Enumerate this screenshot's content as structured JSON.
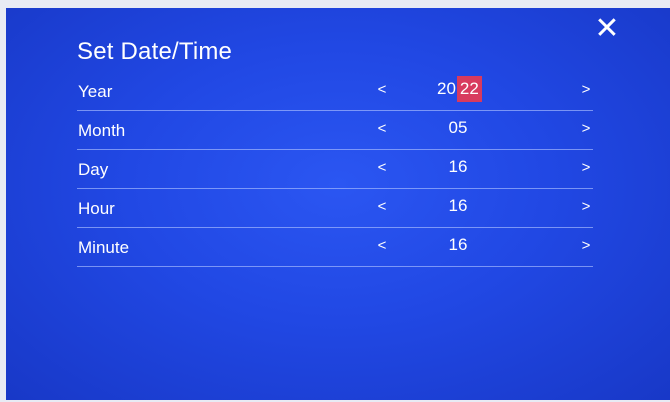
{
  "screen": {
    "title": "Set  Date/Time",
    "close_icon": "close-icon"
  },
  "arrows": {
    "prev": "<",
    "next": ">"
  },
  "fields": {
    "year": {
      "label": "Year",
      "value_prefix": "20",
      "value_selected": "22"
    },
    "month": {
      "label": "Month",
      "value": "05"
    },
    "day": {
      "label": "Day",
      "value": "16"
    },
    "hour": {
      "label": "Hour",
      "value": "16"
    },
    "minute": {
      "label": "Minute",
      "value": "16"
    }
  },
  "colors": {
    "background": "#2148e4",
    "selection": "#d83a5e",
    "text": "#ffffff"
  }
}
